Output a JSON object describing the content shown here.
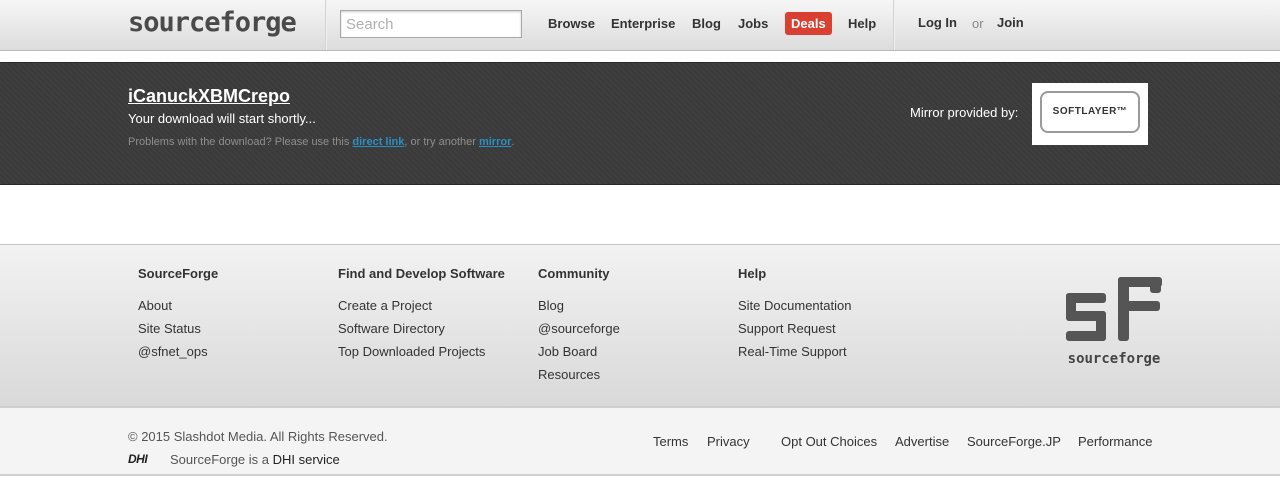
{
  "header": {
    "logo_text": "sourceforge",
    "search": {
      "placeholder": "Search",
      "value": ""
    },
    "nav": [
      {
        "label": "Browse"
      },
      {
        "label": "Enterprise"
      },
      {
        "label": "Blog"
      },
      {
        "label": "Jobs"
      },
      {
        "label": "Deals",
        "highlight": "#d94032"
      },
      {
        "label": "Help"
      }
    ],
    "auth": {
      "login": "Log In",
      "or": "or",
      "join": "Join"
    }
  },
  "download": {
    "project_title": "iCanuckXBMCrepo",
    "message": "Your download will start shortly...",
    "problem_prefix": "Problems with the download? Please use this ",
    "direct_link": "direct link",
    "problem_middle": ", or try another ",
    "mirror_link": "mirror",
    "problem_suffix": ".",
    "mirror_label": "Mirror provided by:",
    "mirror_logo": "SOFTLAYER™"
  },
  "footer": {
    "columns": [
      {
        "heading": "SourceForge",
        "links": [
          "About",
          "Site Status",
          "@sfnet_ops"
        ]
      },
      {
        "heading": "Find and Develop Software",
        "links": [
          "Create a Project",
          "Software Directory",
          "Top Downloaded Projects"
        ]
      },
      {
        "heading": "Community",
        "links": [
          "Blog",
          "@sourceforge",
          "Job Board",
          "Resources"
        ]
      },
      {
        "heading": "Help",
        "links": [
          "Site Documentation",
          "Support Request",
          "Real-Time Support"
        ]
      }
    ],
    "logo_text": "sourceforge"
  },
  "bottom": {
    "copyright": "© 2015 Slashdot Media. All Rights Reserved.",
    "dhi_logo": "DHI",
    "dhi_prefix": "SourceForge is a ",
    "dhi_link": "DHI service",
    "links": [
      "Terms",
      "Privacy",
      "Opt Out Choices",
      "Advertise",
      "SourceForge.JP",
      "Performance"
    ]
  },
  "colors": {
    "accent": "#2b8fc4",
    "deals": "#d94032",
    "band": "#3a3a3a"
  }
}
